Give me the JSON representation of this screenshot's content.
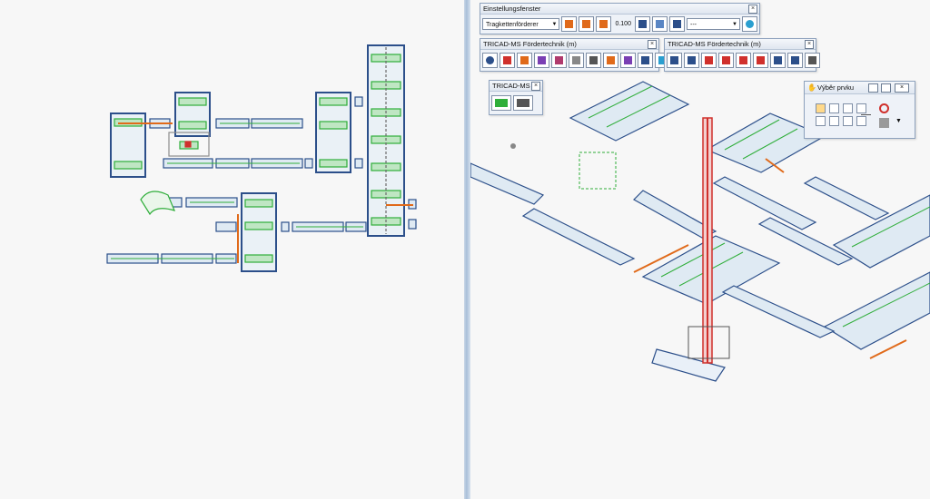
{
  "toolbars": {
    "settings": {
      "title": "Einstellungsfenster",
      "type_value": "Tragkettenförderer",
      "numeric_value": "0.100",
      "layer_value": "---"
    },
    "tricad1": {
      "title": "TRICAD-MS Fördertechnik (m)"
    },
    "tricad2": {
      "title": "TRICAD-MS Fördertechnik (m)"
    },
    "tricad_small": {
      "title": "TRICAD-MS ..."
    },
    "select": {
      "title": "Výběr prvku"
    }
  },
  "colors": {
    "background": "#f7f7f7",
    "frame_blue": "#2c4f8a",
    "roller_green": "#2fae3a",
    "chain_orange": "#e06a1a",
    "lift_red": "#d0302c",
    "neutral_gray": "#6b6b6b"
  }
}
